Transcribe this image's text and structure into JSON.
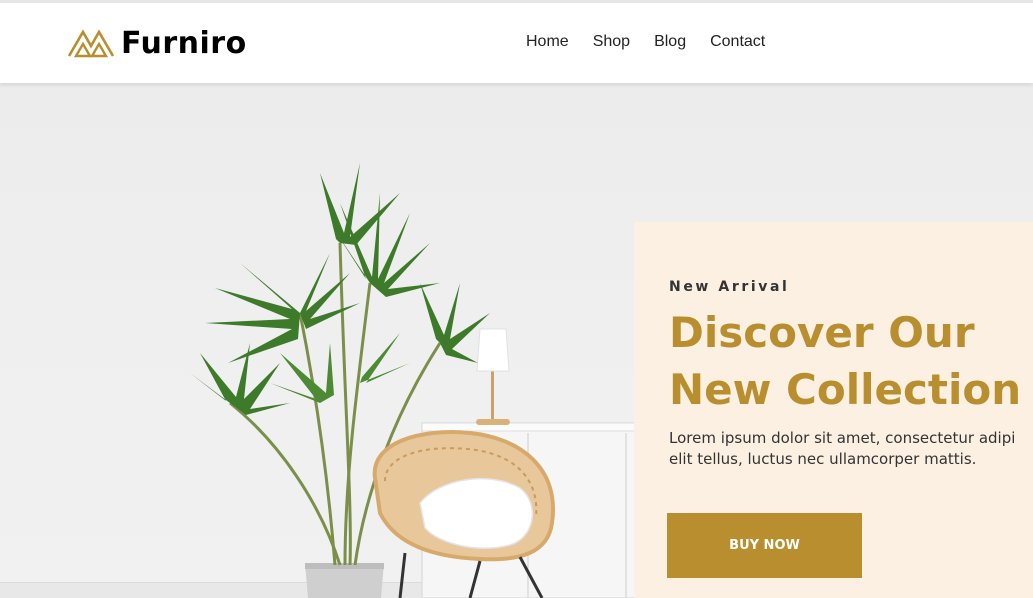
{
  "brand": {
    "name": "Furniro",
    "icon": "furniro-logo-icon",
    "color": "#b88e2f"
  },
  "nav": {
    "items": [
      {
        "label": "Home"
      },
      {
        "label": "Shop"
      },
      {
        "label": "Blog"
      },
      {
        "label": "Contact"
      }
    ]
  },
  "hero": {
    "image": "living-room-plant-rattan-chair-lamp",
    "banner": {
      "eyebrow": "New Arrival",
      "headline_line1": "Discover Our",
      "headline_line2": "New Collection",
      "description_line1": "Lorem ipsum dolor sit amet, consectetur adipi",
      "description_line2": "elit tellus, luctus nec ullamcorper mattis.",
      "cta_label": "BUY NOW",
      "background": "#fcf0e2",
      "accent": "#b88e2f"
    }
  }
}
